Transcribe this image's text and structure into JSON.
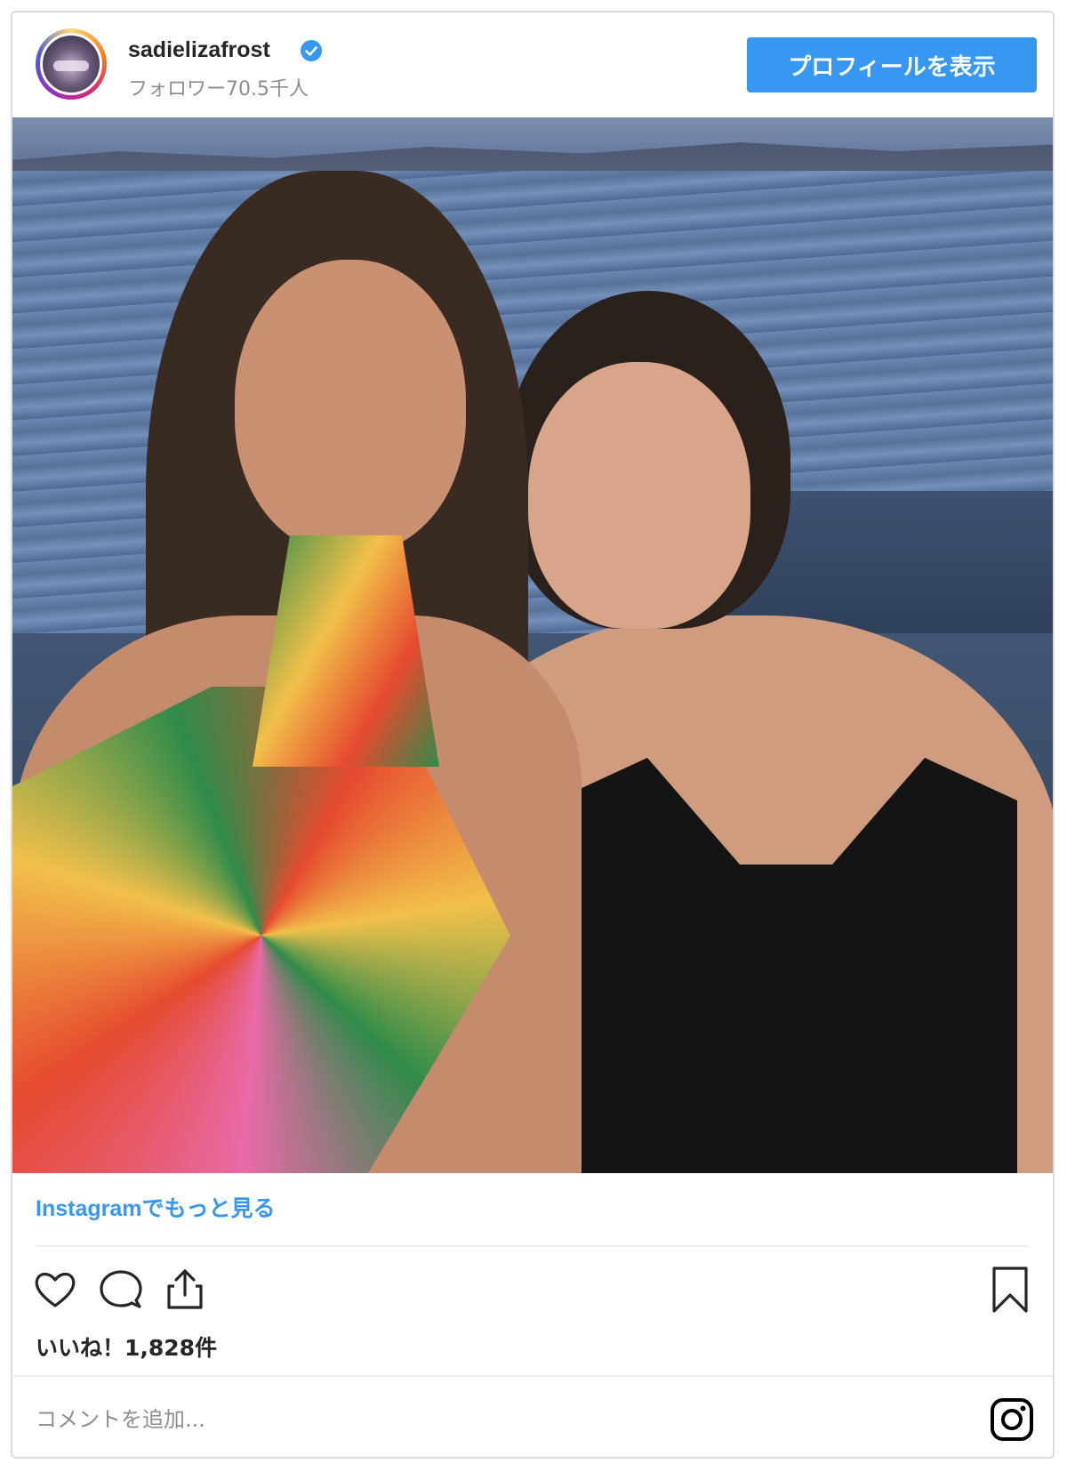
{
  "post": {
    "username": "sadielizafrost",
    "followers": "フォロワー70.5千人",
    "profile_button": "プロフィールを表示",
    "more_link": "Instagramでもっと見る",
    "likes": "いいね！1,828件",
    "comment_placeholder": "コメントを追加..."
  },
  "icons": {
    "verified": "verified-badge-icon",
    "like": "heart-icon",
    "comment": "comment-bubble-icon",
    "share": "share-icon",
    "save": "bookmark-icon",
    "brand": "instagram-icon"
  },
  "colors": {
    "accent": "#3897f0",
    "text": "#262626",
    "muted": "#8e8e8e",
    "border": "#dbdbdb"
  }
}
